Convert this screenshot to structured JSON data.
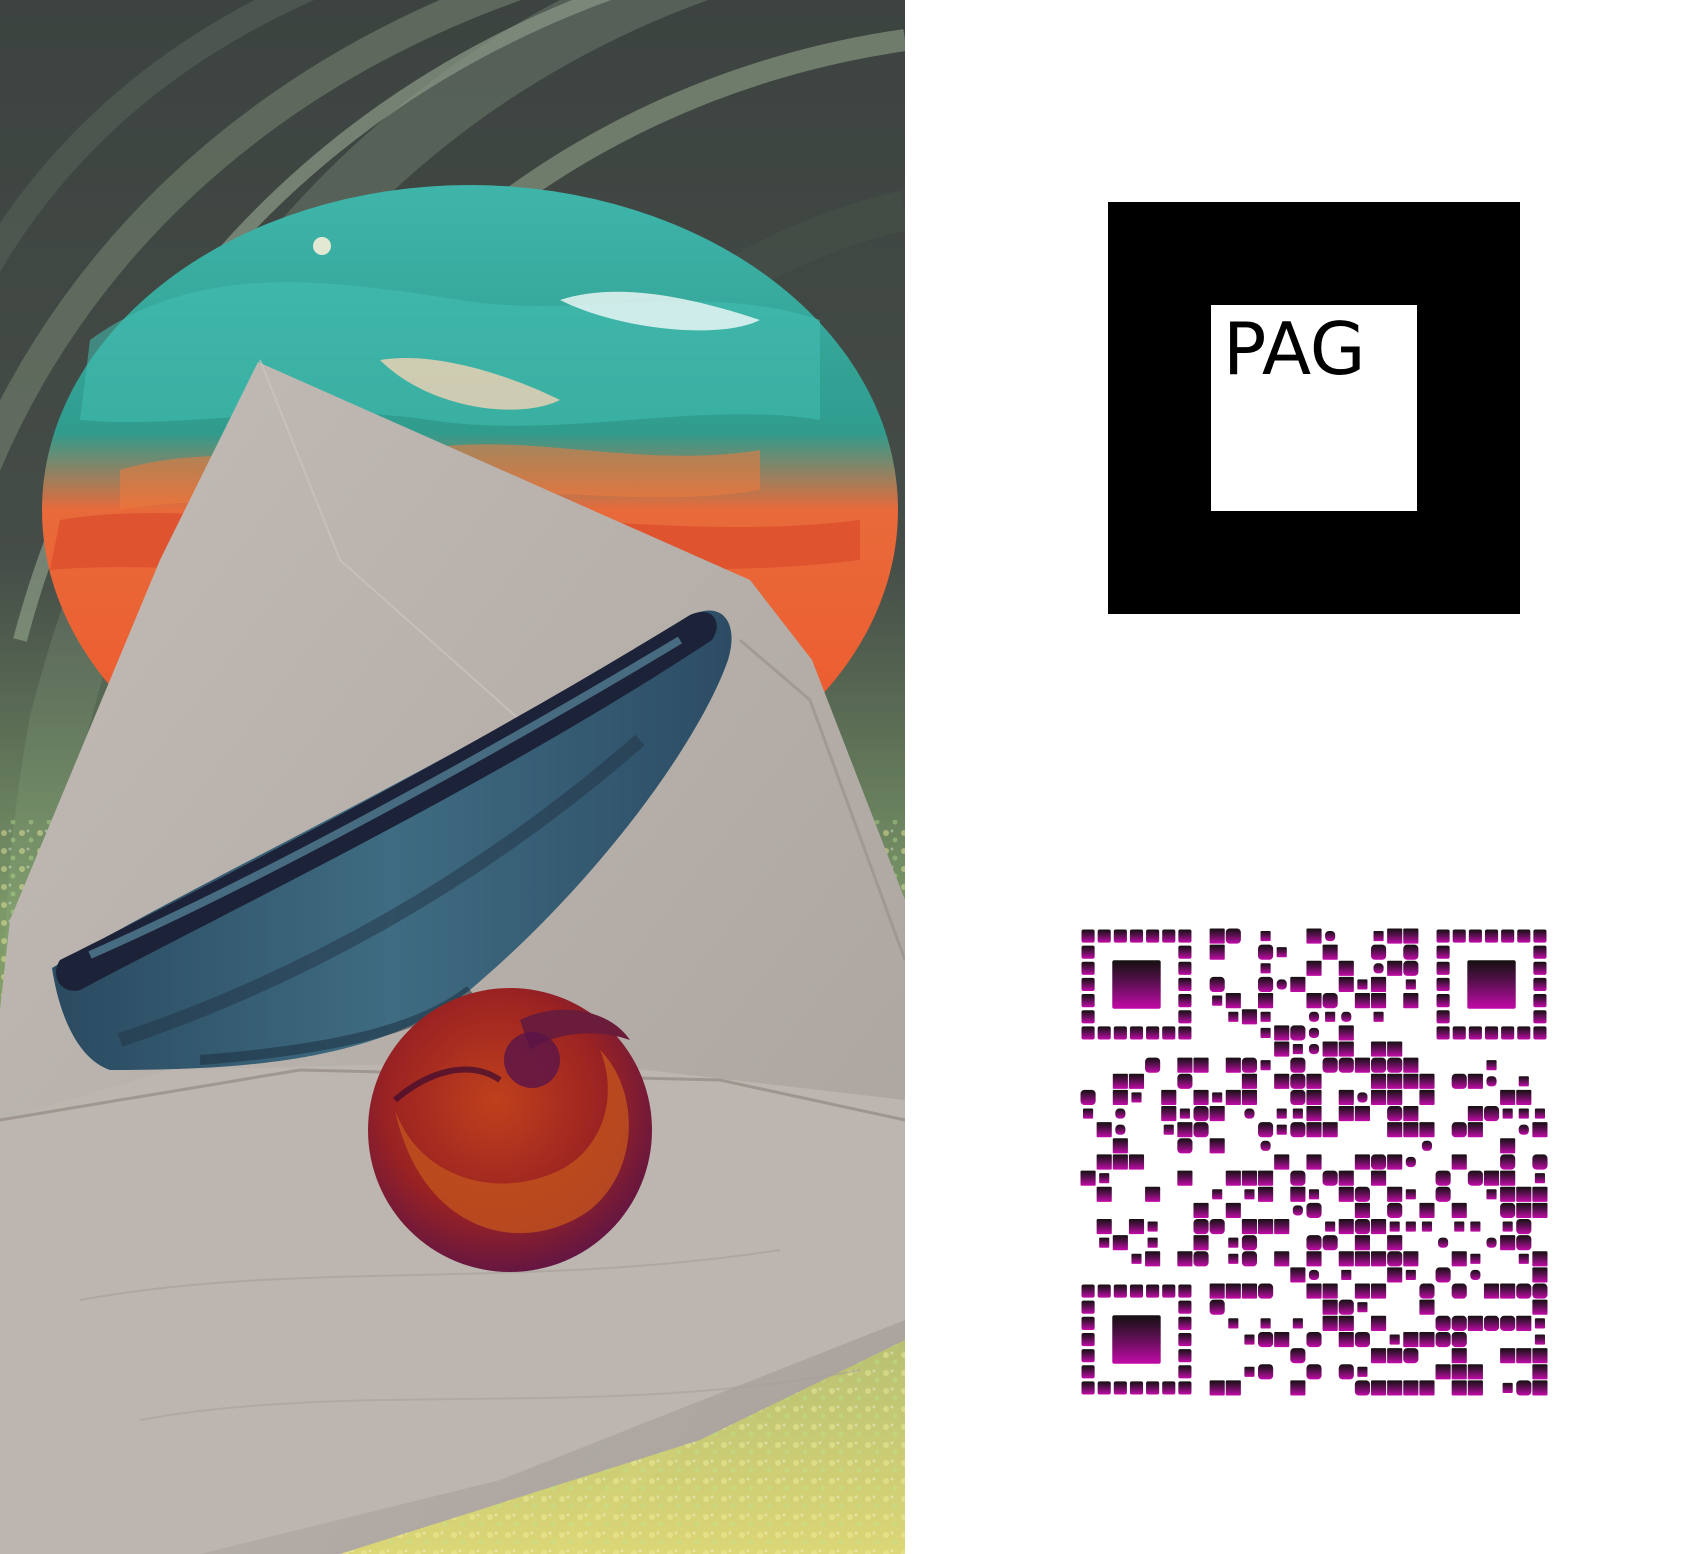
{
  "marker": {
    "label": "PAG",
    "frame_color": "#000000",
    "inner_color": "#ffffff"
  },
  "artwork": {
    "icons": [
      "envelope-icon",
      "bowl-icon",
      "wax-seal-icon"
    ],
    "colors": {
      "tunnel_dark": "#3c4340",
      "tunnel_mid": "#59645b",
      "tunnel_light": "#8c9a88",
      "sky_teal": "#3fb5aa",
      "sky_orange": "#f0582c",
      "paper": "#b3aca6",
      "paper_light": "#c7c1bb",
      "bowl_blue": "#3d6a80",
      "bowl_dark": "#1c2238",
      "seal_red": "#a0221e",
      "seal_purple": "#5a1448",
      "glitter_green": "#9bd47a",
      "glitter_yellow": "#e9e07a"
    }
  },
  "qr": {
    "modules": 29,
    "color_top": "#141010",
    "color_bottom": "#c20aa8"
  }
}
